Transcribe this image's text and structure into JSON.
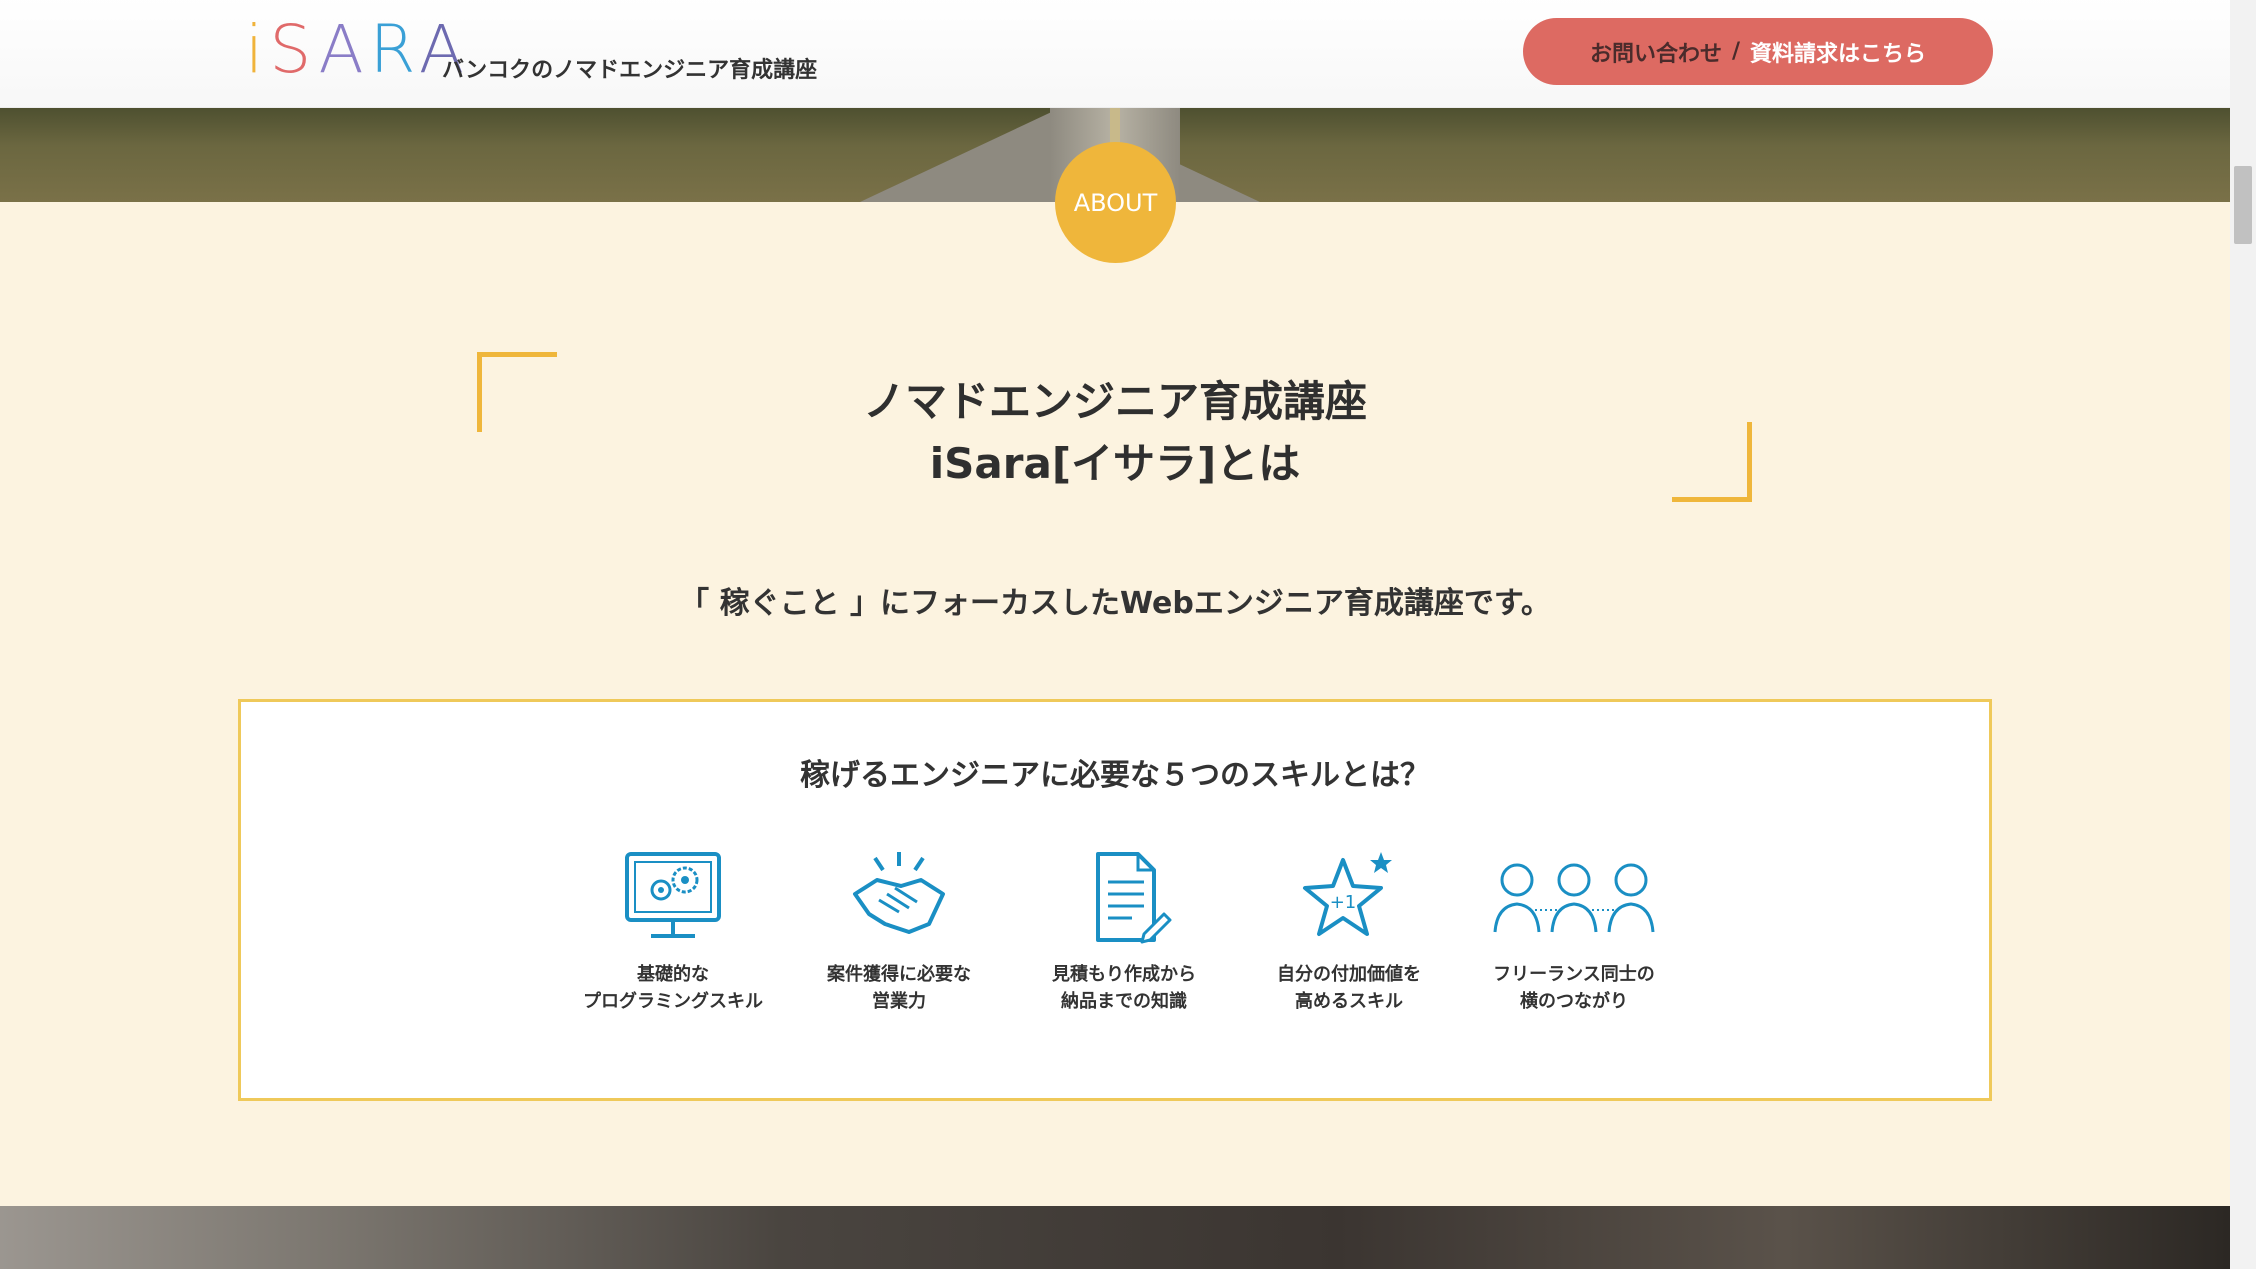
{
  "header": {
    "logo_parts": [
      "i",
      "S",
      "A",
      "R",
      "A"
    ],
    "tagline": "バンコクのノマドエンジニア育成講座",
    "contact_button": {
      "part1": "お問い合わせ",
      "separator": "/",
      "part2": "資料請求はこちら"
    }
  },
  "about": {
    "badge": "ABOUT",
    "heading_line1": "ノマドエンジニア育成講座",
    "heading_line2": "iSara[イサラ]とは",
    "lead": "「 稼ぐこと 」にフォーカスしたWebエンジニア育成講座です。"
  },
  "skills": {
    "title": "稼げるエンジニアに必要な５つのスキルとは？",
    "items": [
      {
        "icon": "computer-gears-icon",
        "caption": "基礎的な\nプログラミングスキル"
      },
      {
        "icon": "handshake-icon",
        "caption": "案件獲得に必要な\n営業力"
      },
      {
        "icon": "document-pen-icon",
        "caption": "見積もり作成から\n納品までの知識"
      },
      {
        "icon": "star-plus-one-icon",
        "caption": "自分の付加価値を\n高めるスキル"
      },
      {
        "icon": "people-network-icon",
        "caption": "フリーランス同士の\n横のつながり"
      }
    ]
  },
  "colors": {
    "accent": "#efb63b",
    "button": "#dd6a62",
    "background": "#fcf3e0",
    "icon": "#1a8fc4"
  }
}
